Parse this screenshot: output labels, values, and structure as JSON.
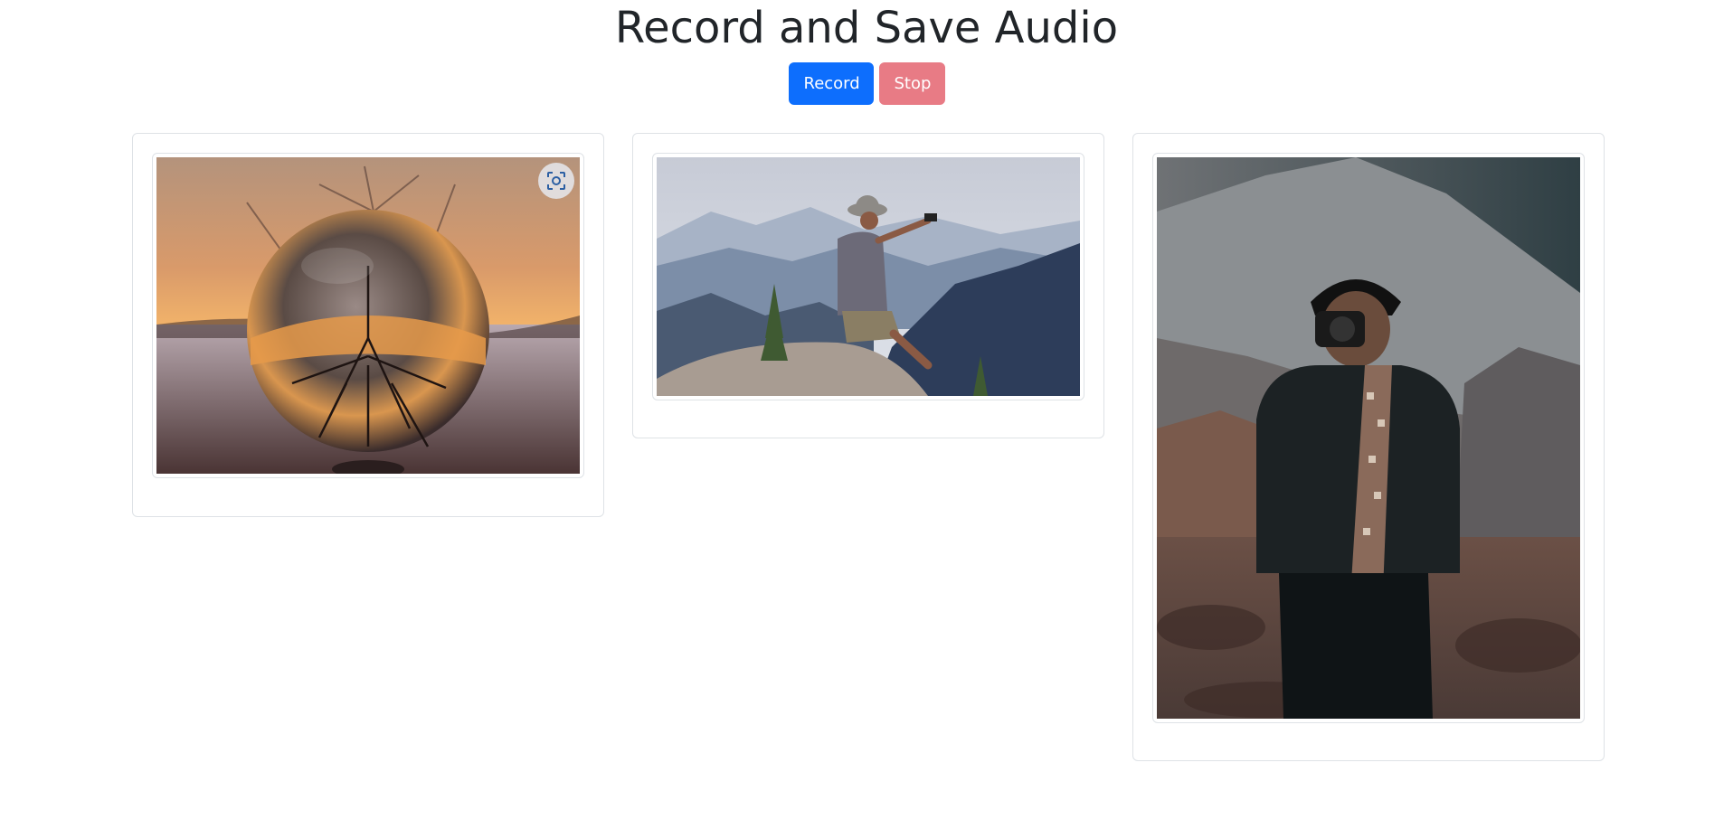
{
  "header": {
    "title": "Record and Save Audio"
  },
  "controls": {
    "record_label": "Record",
    "stop_label": "Stop"
  },
  "gallery": {
    "images": [
      {
        "subject": "crystal ball reflecting tree at sunset",
        "has_lens_button": true
      },
      {
        "subject": "hiker on mountain taking selfie"
      },
      {
        "subject": "photographer with camera in desert"
      }
    ]
  },
  "colors": {
    "primary": "#0d6efd",
    "danger": "#dc3545",
    "border": "#dee2e6"
  },
  "icons": {
    "lens": "visual-search-icon"
  }
}
